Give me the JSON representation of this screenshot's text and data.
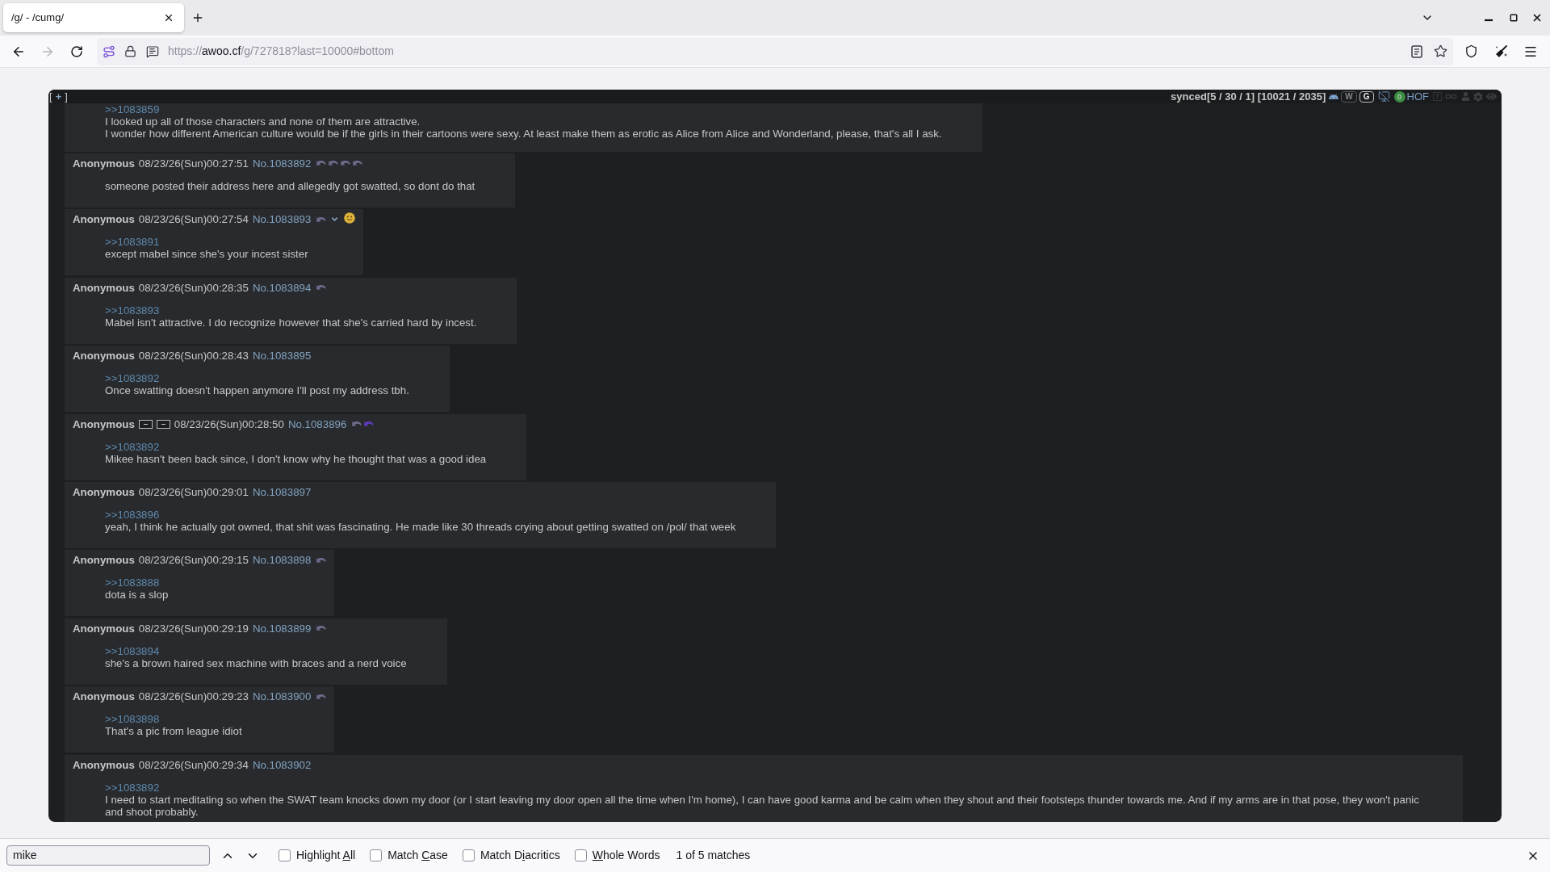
{
  "browser": {
    "tab": {
      "title": "/g/ - /cumg/",
      "selected": true
    },
    "navigation": [
      {
        "kind": "back",
        "disabled": false
      },
      {
        "kind": "forward",
        "disabled": true
      },
      {
        "kind": "reload",
        "disabled": false
      }
    ],
    "url": {
      "scheme": "https://",
      "host": "awoo.cf",
      "path": "/g/727818?last=10000#bottom"
    }
  },
  "thread_toolbar": {
    "expand": {
      "open": "[",
      "label": "+",
      "close": "]"
    },
    "status": "synced[5 / 30 / 1] [10021 / 2035]",
    "toggles": [
      {
        "label": "W",
        "on": false
      },
      {
        "label": "G",
        "on": true
      }
    ],
    "counter": "0",
    "hof": "HOF"
  },
  "posts": [
    {
      "quote": ">>1083859",
      "lines": [
        "I looked up all of those characters and none of them are attractive.",
        "I wonder how different American culture would be if the girls in their cartoons were sexy. At least make them as erotic as Alice from Alice and Wonderland, please, that's all I ask."
      ]
    },
    {
      "name": "Anonymous",
      "date": "08/23/26(Sun)00:27:51",
      "number": "No.1083892",
      "header_icons": [
        {
          "kind": "reply",
          "highlighted": false
        },
        {
          "kind": "reply",
          "highlighted": false
        },
        {
          "kind": "reply",
          "highlighted": false
        },
        {
          "kind": "reply",
          "highlighted": false
        }
      ],
      "lines": [
        "someone posted their address here and allegedly got swatted, so dont do that"
      ]
    },
    {
      "name": "Anonymous",
      "date": "08/23/26(Sun)00:27:54",
      "number": "No.1083893",
      "header_icons": [
        {
          "kind": "reply",
          "highlighted": false
        },
        {
          "kind": "chevron",
          "highlighted": false
        },
        {
          "kind": "smiley",
          "highlighted": false
        }
      ],
      "quote": ">>1083891",
      "lines": [
        "except mabel since she's your incest sister"
      ]
    },
    {
      "name": "Anonymous",
      "date": "08/23/26(Sun)00:28:35",
      "number": "No.1083894",
      "header_icons": [
        {
          "kind": "reply",
          "highlighted": false
        }
      ],
      "quote": ">>1083893",
      "lines": [
        "Mabel isn't attractive. I do recognize however that she's carried hard by incest."
      ]
    },
    {
      "name": "Anonymous",
      "date": "08/23/26(Sun)00:28:43",
      "number": "No.1083895",
      "quote": ">>1083892",
      "lines": [
        "Once swatting doesn't happen anymore I'll post my address tbh."
      ]
    },
    {
      "name": "Anonymous",
      "name_buttons": [
        {
          "kind": "minus"
        },
        {
          "kind": "minus"
        }
      ],
      "date": "08/23/26(Sun)00:28:50",
      "number": "No.1083896",
      "header_icons": [
        {
          "kind": "reply",
          "highlighted": false
        },
        {
          "kind": "reply",
          "highlighted": true
        }
      ],
      "quote": ">>1083892",
      "lines": [
        "Mikee hasn't been back since, I don't know why he thought that was a good idea"
      ]
    },
    {
      "name": "Anonymous",
      "date": "08/23/26(Sun)00:29:01",
      "number": "No.1083897",
      "quote": ">>1083896",
      "lines": [
        "yeah, I think he actually got owned, that shit was fascinating. He made like 30 threads crying about getting swatted on /pol/ that week"
      ]
    },
    {
      "name": "Anonymous",
      "date": "08/23/26(Sun)00:29:15",
      "number": "No.1083898",
      "header_icons": [
        {
          "kind": "reply",
          "highlighted": false
        }
      ],
      "quote": ">>1083888",
      "lines": [
        "dota is a slop"
      ]
    },
    {
      "name": "Anonymous",
      "date": "08/23/26(Sun)00:29:19",
      "number": "No.1083899",
      "header_icons": [
        {
          "kind": "reply",
          "highlighted": false
        }
      ],
      "quote": ">>1083894",
      "lines": [
        "she's a brown haired sex machine with braces and a nerd voice"
      ]
    },
    {
      "name": "Anonymous",
      "date": "08/23/26(Sun)00:29:23",
      "number": "No.1083900",
      "header_icons": [
        {
          "kind": "reply",
          "highlighted": false
        }
      ],
      "quote": ">>1083898",
      "lines": [
        "That's a pic from league idiot"
      ]
    },
    {
      "name": "Anonymous",
      "date": "08/23/26(Sun)00:29:34",
      "number": "No.1083902",
      "quote": ">>1083892",
      "lines": [
        "I need to start meditating so when the SWAT team knocks down my door (or I start leaving my door open all the time when I'm home), I can have good karma and be calm when they shout and their footsteps thunder towards me. And if my arms are in that pose, they won't panic and shoot probably."
      ]
    }
  ],
  "find_bar": {
    "query": "mike",
    "options": [
      {
        "before": "Highlight ",
        "key": "A",
        "after": "ll",
        "checked": false
      },
      {
        "before": "Match ",
        "key": "C",
        "after": "ase",
        "checked": false
      },
      {
        "before": "Match D",
        "key": "i",
        "after": "acritics",
        "checked": false
      },
      {
        "key": "W",
        "after": "hole Words",
        "checked": false
      }
    ],
    "result": "1 of 5 matches"
  }
}
